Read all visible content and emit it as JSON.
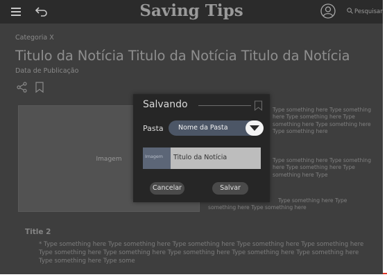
{
  "header": {
    "app_title": "Saving Tips",
    "search_label": "Pesquisar"
  },
  "article": {
    "category": "Categoria X",
    "headline": "Titulo da Notícia Titulo da Notícia Titulo da Notícia",
    "pub_date": "Data de Publicação",
    "image_label": "Imagem",
    "side_text_1": "Type something here Type something here Type something here Type something here Type something here Type something here",
    "side_text_2": "Type something here Type something here Type something here Type something here Type",
    "bottom_side_text": "Type something here Type something here Type something here",
    "section_title": "Title 2",
    "paragraph": "* Type something here Type something here Type something here Type something here Type something here Type something here Type something here Type something here Type something here Type something here Type something here Type some"
  },
  "modal": {
    "title": "Salvando",
    "folder_label": "Pasta",
    "folder_value": "Nome da Pasta",
    "preview_image_label": "Imagem",
    "preview_title": "Titulo da Notícia",
    "cancel_label": "Cancelar",
    "save_label": "Salvar"
  },
  "colors": {
    "background": "#3e3e3e",
    "header": "#2b2b2b",
    "modal": "#262626",
    "select": "#4c5666"
  },
  "icons": [
    "menu-icon",
    "back-icon",
    "user-icon",
    "search-icon",
    "share-icon",
    "bookmark-icon",
    "chevron-down-icon"
  ]
}
